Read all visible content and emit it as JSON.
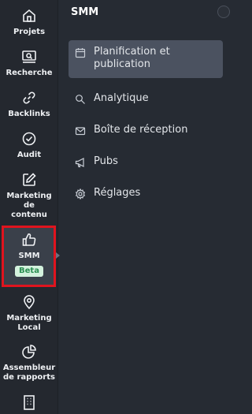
{
  "rail": {
    "items": [
      {
        "label": "Projets",
        "icon": "home-icon"
      },
      {
        "label": "Recherche",
        "icon": "search-screen-icon"
      },
      {
        "label": "Backlinks",
        "icon": "link-icon"
      },
      {
        "label": "Audit",
        "icon": "check-circle-icon"
      },
      {
        "label": "Marketing\nde\ncontenu",
        "icon": "edit-icon"
      },
      {
        "label": "SMM",
        "icon": "thumbs-up-icon",
        "badge": "Beta"
      },
      {
        "label": "Marketing\nLocal",
        "icon": "map-pin-icon"
      },
      {
        "label": "Assembleur\nde rapports",
        "icon": "pie-chart-icon"
      },
      {
        "label": "",
        "icon": "building-icon"
      }
    ],
    "active_highlight_color": "#e0141e",
    "badge_color": "#d4f2de"
  },
  "panel": {
    "title": "SMM",
    "items": [
      {
        "label": "Planification et\npublication",
        "icon": "calendar-icon",
        "selected": true
      },
      {
        "label": "Analytique",
        "icon": "search-icon"
      },
      {
        "label": "Boîte de réception",
        "icon": "mail-icon"
      },
      {
        "label": "Pubs",
        "icon": "megaphone-icon"
      },
      {
        "label": "Réglages",
        "icon": "gear-icon"
      }
    ]
  }
}
